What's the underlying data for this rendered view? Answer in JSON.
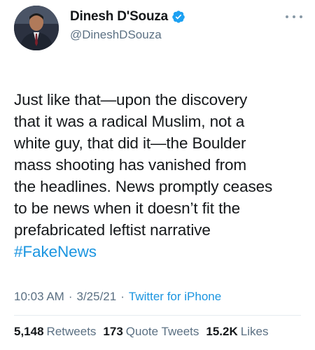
{
  "author": {
    "display_name": "Dinesh D'Souza",
    "handle": "@DineshDSouza"
  },
  "tweet": {
    "text": "Just like that—upon the discovery\nthat it was a radical Muslim, not a\nwhite guy, that did it—the Boulder\nmass shooting has vanished from\nthe headlines. News promptly ceases\nto be news when it doesn’t fit the\nprefabricated leftist narrative",
    "hashtag": "#FakeNews"
  },
  "meta": {
    "time": "10:03 AM",
    "separator": "·",
    "date": "3/25/21",
    "source": "Twitter for iPhone"
  },
  "stats": {
    "retweets_count": "5,148",
    "retweets_label": "Retweets",
    "quotes_count": "173",
    "quotes_label": "Quote Tweets",
    "likes_count": "15.2K",
    "likes_label": "Likes"
  },
  "colors": {
    "link": "#1b95e0",
    "verified": "#1da1f2",
    "secondary_text": "#5b7083"
  },
  "icons": {
    "verified": "verified-badge-icon",
    "more": "more-options-icon"
  }
}
